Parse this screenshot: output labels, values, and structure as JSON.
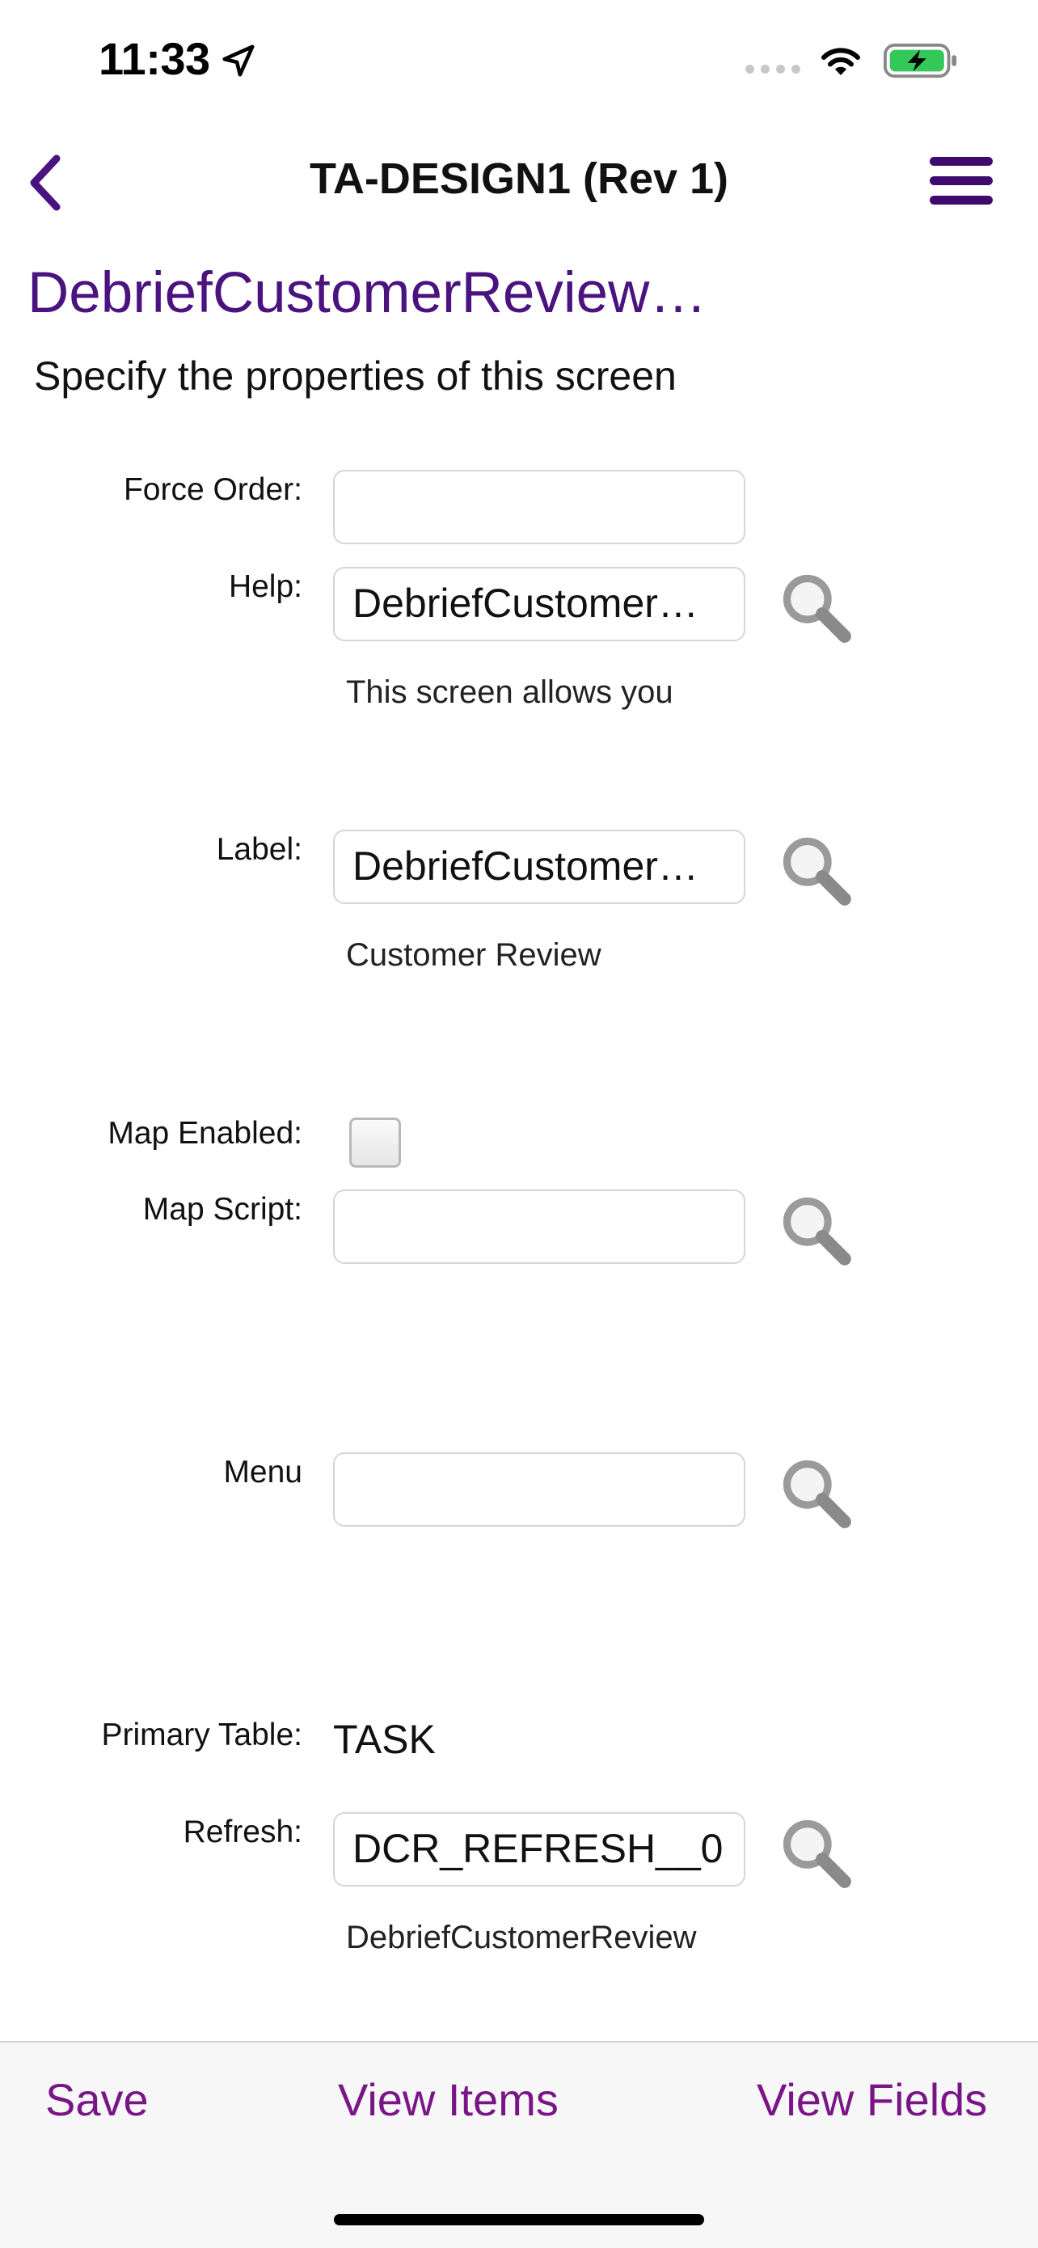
{
  "status_bar": {
    "time": "11:33"
  },
  "nav": {
    "title": "TA-DESIGN1 (Rev 1)"
  },
  "page": {
    "title": "DebriefCustomerReview…",
    "subtitle": "Specify the properties of this screen"
  },
  "form": {
    "force_order": {
      "label": "Force Order:",
      "value": ""
    },
    "help": {
      "label": "Help:",
      "value": "DebriefCustomer…",
      "note": "This screen allows you"
    },
    "label_field": {
      "label": "Label:",
      "value": "DebriefCustomer…",
      "note": "Customer Review"
    },
    "map_enabled": {
      "label": "Map Enabled:",
      "checked": false
    },
    "map_script": {
      "label": "Map Script:",
      "value": ""
    },
    "menu": {
      "label": "Menu",
      "value": ""
    },
    "primary_table": {
      "label": "Primary Table:",
      "value": "TASK"
    },
    "refresh": {
      "label": "Refresh:",
      "value": "DCR_REFRESH__0",
      "note": "DebriefCustomerReview"
    }
  },
  "toolbar": {
    "save_label": "Save",
    "view_items_label": "View Items",
    "view_fields_label": "View Fields"
  },
  "colors": {
    "accent": "#4a137f",
    "toolbar_text": "#7a1588",
    "battery": "#34c759"
  },
  "icons": [
    "location-arrow-icon",
    "cellular-dots-icon",
    "wifi-icon",
    "battery-charging-icon",
    "chevron-left-icon",
    "hamburger-menu-icon",
    "search-icon"
  ]
}
